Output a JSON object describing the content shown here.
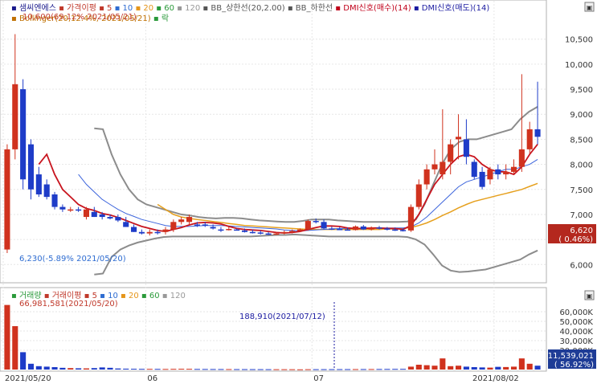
{
  "legend_top": [
    {
      "label": "샘씨엔에스",
      "color": "#1a1a8c",
      "marker": "#d0322a"
    },
    {
      "label": "가격이평",
      "color": "#c0392b"
    },
    {
      "label": "5",
      "color": "#c0392b"
    },
    {
      "label": "10",
      "color": "#2e6cd1"
    },
    {
      "label": "20",
      "color": "#e5951a"
    },
    {
      "label": "60",
      "color": "#2a9a3a"
    },
    {
      "label": "120",
      "color": "#999999"
    },
    {
      "label": "BB_상한선(20,2.00)",
      "color": "#555555"
    },
    {
      "label": "BB_하한선",
      "color": "#555555"
    },
    {
      "label": "DMI신호(매수)(14)",
      "color": "#c0001a"
    },
    {
      "label": "DMI신호(매도)(14)",
      "color": "#1a1aa0"
    }
  ],
  "legend_top2": [
    {
      "label": "Bollinger(20,12.4%, 2021/05/21)",
      "color": "#c07000"
    },
    {
      "label": "락",
      "color": "#2a9a3a"
    }
  ],
  "annotations": {
    "high": "10,600(69.12% 2021/05/21)",
    "low": "6,230(-5.89% 2021/05/20)",
    "volume_max": "66,981,581(2021/05/20)",
    "volume_mark": "188,910(2021/07/12)"
  },
  "current_price": {
    "value": "6,620",
    "change": "(  0.46%)"
  },
  "current_volume": {
    "value": "11,539,021",
    "change": "(  56.92%)"
  },
  "volume_legend": [
    {
      "label": "거래량",
      "color": "#2a9a3a"
    },
    {
      "label": "거래이평",
      "color": "#c0392b"
    },
    {
      "label": "5",
      "color": "#c0392b"
    },
    {
      "label": "10",
      "color": "#2e6cd1"
    },
    {
      "label": "20",
      "color": "#e5951a"
    },
    {
      "label": "60",
      "color": "#2a9a3a"
    },
    {
      "label": "120",
      "color": "#999999"
    }
  ],
  "colors": {
    "up": "#d0321e",
    "down": "#1e3cc8",
    "ma5": "#c8141e",
    "ma10": "#3c64dc",
    "ma20": "#e6a01e",
    "bb": "#8c8c8c",
    "grid": "#e6e6e6",
    "current_bg": "#b4281e",
    "volume_current_bg": "#1e3c96"
  },
  "chart_data": [
    {
      "type": "candlestick",
      "title": "샘씨엔에스",
      "x_ticks": [
        "2021/05/20",
        "06",
        "07",
        "2021/08/02"
      ],
      "y_ticks": [
        "10,500",
        "10,000",
        "9,500",
        "9,000",
        "8,500",
        "8,000",
        "7,500",
        "7,000",
        "6,500",
        "6,000"
      ],
      "ylim": [
        5700,
        10800
      ],
      "candles": [
        {
          "o": 6300,
          "h": 8400,
          "l": 6230,
          "c": 8300
        },
        {
          "o": 8300,
          "h": 10600,
          "l": 8100,
          "c": 9600
        },
        {
          "o": 9500,
          "h": 9700,
          "l": 7500,
          "c": 7700
        },
        {
          "o": 8400,
          "h": 8500,
          "l": 7300,
          "c": 7500
        },
        {
          "o": 7800,
          "h": 7950,
          "l": 7350,
          "c": 7400
        },
        {
          "o": 7600,
          "h": 7700,
          "l": 7300,
          "c": 7350
        },
        {
          "o": 7400,
          "h": 7450,
          "l": 7100,
          "c": 7150
        },
        {
          "o": 7150,
          "h": 7200,
          "l": 7050,
          "c": 7100
        },
        {
          "o": 7100,
          "h": 7150,
          "l": 7050,
          "c": 7100
        },
        {
          "o": 7100,
          "h": 7150,
          "l": 7050,
          "c": 7080
        },
        {
          "o": 6950,
          "h": 7150,
          "l": 6900,
          "c": 7100
        },
        {
          "o": 7050,
          "h": 7150,
          "l": 6950,
          "c": 6950
        },
        {
          "o": 7000,
          "h": 7050,
          "l": 6900,
          "c": 6950
        },
        {
          "o": 6950,
          "h": 7000,
          "l": 6900,
          "c": 6920
        },
        {
          "o": 6950,
          "h": 7000,
          "l": 6850,
          "c": 6880
        },
        {
          "o": 6850,
          "h": 6950,
          "l": 6750,
          "c": 6750
        },
        {
          "o": 6750,
          "h": 6800,
          "l": 6650,
          "c": 6650
        },
        {
          "o": 6650,
          "h": 6700,
          "l": 6600,
          "c": 6620
        },
        {
          "o": 6620,
          "h": 6700,
          "l": 6580,
          "c": 6650
        },
        {
          "o": 6650,
          "h": 6700,
          "l": 6600,
          "c": 6630
        },
        {
          "o": 6650,
          "h": 6750,
          "l": 6600,
          "c": 6700
        },
        {
          "o": 6700,
          "h": 6900,
          "l": 6650,
          "c": 6850
        },
        {
          "o": 6850,
          "h": 6950,
          "l": 6800,
          "c": 6900
        },
        {
          "o": 6850,
          "h": 7000,
          "l": 6800,
          "c": 6950
        },
        {
          "o": 6800,
          "h": 6850,
          "l": 6750,
          "c": 6780
        },
        {
          "o": 6800,
          "h": 6850,
          "l": 6750,
          "c": 6780
        },
        {
          "o": 6750,
          "h": 6800,
          "l": 6700,
          "c": 6720
        },
        {
          "o": 6700,
          "h": 6750,
          "l": 6650,
          "c": 6680
        },
        {
          "o": 6700,
          "h": 6750,
          "l": 6680,
          "c": 6710
        },
        {
          "o": 6700,
          "h": 6720,
          "l": 6680,
          "c": 6690
        },
        {
          "o": 6680,
          "h": 6720,
          "l": 6640,
          "c": 6650
        },
        {
          "o": 6650,
          "h": 6700,
          "l": 6620,
          "c": 6640
        },
        {
          "o": 6640,
          "h": 6680,
          "l": 6600,
          "c": 6620
        },
        {
          "o": 6620,
          "h": 6650,
          "l": 6590,
          "c": 6600
        },
        {
          "o": 6600,
          "h": 6650,
          "l": 6590,
          "c": 6620
        },
        {
          "o": 6620,
          "h": 6680,
          "l": 6600,
          "c": 6650
        },
        {
          "o": 6650,
          "h": 6700,
          "l": 6620,
          "c": 6670
        },
        {
          "o": 6670,
          "h": 6720,
          "l": 6650,
          "c": 6700
        },
        {
          "o": 6700,
          "h": 6900,
          "l": 6680,
          "c": 6870
        },
        {
          "o": 6870,
          "h": 6920,
          "l": 6820,
          "c": 6850
        },
        {
          "o": 6850,
          "h": 6900,
          "l": 6700,
          "c": 6720
        },
        {
          "o": 6720,
          "h": 6760,
          "l": 6690,
          "c": 6710
        },
        {
          "o": 6710,
          "h": 6750,
          "l": 6690,
          "c": 6700
        },
        {
          "o": 6700,
          "h": 6740,
          "l": 6680,
          "c": 6690
        },
        {
          "o": 6690,
          "h": 6780,
          "l": 6680,
          "c": 6760
        },
        {
          "o": 6760,
          "h": 6790,
          "l": 6690,
          "c": 6700
        },
        {
          "o": 6700,
          "h": 6760,
          "l": 6680,
          "c": 6740
        },
        {
          "o": 6740,
          "h": 6770,
          "l": 6700,
          "c": 6720
        },
        {
          "o": 6720,
          "h": 6750,
          "l": 6680,
          "c": 6700
        },
        {
          "o": 6700,
          "h": 6740,
          "l": 6670,
          "c": 6690
        },
        {
          "o": 6690,
          "h": 6720,
          "l": 6660,
          "c": 6680
        },
        {
          "o": 6680,
          "h": 7200,
          "l": 6650,
          "c": 7150
        },
        {
          "o": 7150,
          "h": 7700,
          "l": 7100,
          "c": 7600
        },
        {
          "o": 7600,
          "h": 8000,
          "l": 7500,
          "c": 7900
        },
        {
          "o": 7900,
          "h": 8300,
          "l": 7800,
          "c": 8000
        },
        {
          "o": 7800,
          "h": 9100,
          "l": 7700,
          "c": 8050
        },
        {
          "o": 8050,
          "h": 8500,
          "l": 7800,
          "c": 8400
        },
        {
          "o": 8500,
          "h": 9000,
          "l": 8100,
          "c": 8550
        },
        {
          "o": 8500,
          "h": 8900,
          "l": 8000,
          "c": 8150
        },
        {
          "o": 8050,
          "h": 8100,
          "l": 7700,
          "c": 7750
        },
        {
          "o": 7850,
          "h": 7950,
          "l": 7500,
          "c": 7550
        },
        {
          "o": 7700,
          "h": 7950,
          "l": 7600,
          "c": 7900
        },
        {
          "o": 7900,
          "h": 8000,
          "l": 7700,
          "c": 7800
        },
        {
          "o": 7800,
          "h": 8000,
          "l": 7700,
          "c": 7850
        },
        {
          "o": 7850,
          "h": 8100,
          "l": 7800,
          "c": 7950
        },
        {
          "o": 7950,
          "h": 9800,
          "l": 7850,
          "c": 8300
        },
        {
          "o": 8300,
          "h": 8850,
          "l": 8200,
          "c": 8700
        },
        {
          "o": 8700,
          "h": 9650,
          "l": 8400,
          "c": 8550
        }
      ],
      "ma5": [
        null,
        null,
        null,
        null,
        8000,
        8200,
        7800,
        7500,
        7350,
        7200,
        7120,
        7080,
        7020,
        6990,
        6940,
        6880,
        6820,
        6760,
        6720,
        6680,
        6660,
        6700,
        6740,
        6790,
        6830,
        6840,
        6830,
        6810,
        6760,
        6720,
        6700,
        6690,
        6680,
        6660,
        6640,
        6630,
        6640,
        6660,
        6700,
        6740,
        6770,
        6770,
        6760,
        6730,
        6720,
        6720,
        6730,
        6730,
        6720,
        6720,
        6700,
        6780,
        7000,
        7300,
        7600,
        7800,
        8000,
        8150,
        8200,
        8150,
        8000,
        7900,
        7850,
        7850,
        7800,
        7950,
        8200,
        8400
      ],
      "ma10": [
        null,
        null,
        null,
        null,
        null,
        null,
        null,
        null,
        null,
        7800,
        7600,
        7450,
        7300,
        7200,
        7100,
        7020,
        6960,
        6900,
        6860,
        6820,
        6780,
        6760,
        6760,
        6760,
        6770,
        6780,
        6780,
        6780,
        6770,
        6760,
        6750,
        6740,
        6730,
        6720,
        6710,
        6690,
        6680,
        6670,
        6680,
        6690,
        6700,
        6710,
        6720,
        6720,
        6720,
        6720,
        6720,
        6730,
        6730,
        6730,
        6730,
        6750,
        6830,
        6950,
        7100,
        7250,
        7400,
        7550,
        7650,
        7700,
        7750,
        7800,
        7850,
        7900,
        7900,
        7950,
        8000,
        8100
      ],
      "ma20": [
        null,
        null,
        null,
        null,
        null,
        null,
        null,
        null,
        null,
        null,
        null,
        null,
        null,
        null,
        null,
        null,
        null,
        null,
        null,
        7200,
        7100,
        7000,
        6950,
        6920,
        6900,
        6880,
        6860,
        6840,
        6820,
        6800,
        6780,
        6770,
        6760,
        6750,
        6740,
        6730,
        6720,
        6710,
        6700,
        6700,
        6700,
        6700,
        6700,
        6700,
        6700,
        6700,
        6700,
        6700,
        6710,
        6710,
        6720,
        6740,
        6780,
        6830,
        6900,
        6980,
        7050,
        7130,
        7200,
        7260,
        7300,
        7340,
        7380,
        7420,
        7460,
        7500,
        7560,
        7620
      ],
      "bb_upper": [
        null,
        null,
        null,
        null,
        null,
        null,
        null,
        null,
        null,
        null,
        null,
        null,
        null,
        null,
        null,
        null,
        null,
        null,
        null,
        null,
        null,
        null,
        null,
        null,
        null,
        null,
        null,
        null,
        null,
        null,
        null,
        null,
        null,
        null,
        null,
        null,
        null,
        null,
        null,
        null,
        null,
        null,
        null,
        null,
        null,
        null,
        null,
        null,
        null,
        null,
        null,
        null,
        null,
        null,
        null,
        null,
        null,
        null,
        null,
        null,
        null,
        null,
        null,
        null,
        null,
        null,
        null,
        null
      ],
      "bb_upper_pts": [
        [
          8720,
          0
        ],
        [
          8700,
          1
        ],
        [
          8200,
          2
        ],
        [
          7800,
          3
        ],
        [
          7500,
          4
        ],
        [
          7300,
          5
        ],
        [
          7200,
          6
        ],
        [
          7150,
          7
        ],
        [
          7100,
          8
        ],
        [
          7050,
          9
        ],
        [
          7000,
          10
        ],
        [
          6980,
          11
        ],
        [
          6950,
          12
        ],
        [
          6930,
          13
        ],
        [
          6920,
          14
        ],
        [
          6930,
          15
        ],
        [
          6930,
          16
        ],
        [
          6920,
          17
        ],
        [
          6900,
          18
        ],
        [
          6880,
          19
        ],
        [
          6870,
          20
        ],
        [
          6860,
          21
        ],
        [
          6850,
          22
        ],
        [
          6850,
          23
        ],
        [
          6870,
          24
        ],
        [
          6900,
          25
        ],
        [
          6900,
          26
        ],
        [
          6900,
          27
        ],
        [
          6880,
          28
        ],
        [
          6870,
          29
        ],
        [
          6860,
          30
        ],
        [
          6850,
          31
        ],
        [
          6850,
          32
        ],
        [
          6850,
          33
        ],
        [
          6850,
          34
        ],
        [
          6850,
          35
        ],
        [
          6860,
          36
        ],
        [
          6900,
          37
        ],
        [
          7200,
          38
        ],
        [
          7600,
          39
        ],
        [
          8000,
          40
        ],
        [
          8300,
          41
        ],
        [
          8450,
          42
        ],
        [
          8500,
          43
        ],
        [
          8500,
          44
        ],
        [
          8550,
          45
        ],
        [
          8600,
          46
        ],
        [
          8650,
          47
        ],
        [
          8700,
          48
        ],
        [
          8900,
          49
        ],
        [
          9050,
          50
        ],
        [
          9150,
          51
        ]
      ],
      "bb_lower_pts": [
        [
          5800,
          0
        ],
        [
          5820,
          1
        ],
        [
          6150,
          2
        ],
        [
          6300,
          3
        ],
        [
          6380,
          4
        ],
        [
          6440,
          5
        ],
        [
          6480,
          6
        ],
        [
          6520,
          7
        ],
        [
          6550,
          8
        ],
        [
          6560,
          9
        ],
        [
          6560,
          10
        ],
        [
          6560,
          11
        ],
        [
          6560,
          12
        ],
        [
          6560,
          13
        ],
        [
          6560,
          14
        ],
        [
          6560,
          15
        ],
        [
          6560,
          16
        ],
        [
          6560,
          17
        ],
        [
          6560,
          18
        ],
        [
          6570,
          19
        ],
        [
          6580,
          20
        ],
        [
          6590,
          21
        ],
        [
          6590,
          22
        ],
        [
          6600,
          23
        ],
        [
          6590,
          24
        ],
        [
          6580,
          25
        ],
        [
          6570,
          26
        ],
        [
          6560,
          27
        ],
        [
          6560,
          28
        ],
        [
          6560,
          29
        ],
        [
          6560,
          30
        ],
        [
          6560,
          31
        ],
        [
          6560,
          32
        ],
        [
          6560,
          33
        ],
        [
          6560,
          34
        ],
        [
          6560,
          35
        ],
        [
          6550,
          36
        ],
        [
          6500,
          37
        ],
        [
          6400,
          38
        ],
        [
          6200,
          39
        ],
        [
          5980,
          40
        ],
        [
          5880,
          41
        ],
        [
          5850,
          42
        ],
        [
          5860,
          43
        ],
        [
          5880,
          44
        ],
        [
          5900,
          45
        ],
        [
          5950,
          46
        ],
        [
          6000,
          47
        ],
        [
          6050,
          48
        ],
        [
          6100,
          49
        ],
        [
          6200,
          50
        ],
        [
          6280,
          51
        ]
      ],
      "volume": [
        66981581,
        45000000,
        18000000,
        6000000,
        3500000,
        3000000,
        2500000,
        1800000,
        1500000,
        1300000,
        1200000,
        1500000,
        2200000,
        1800000,
        1100000,
        900000,
        800000,
        700000,
        700000,
        650000,
        600000,
        700000,
        800000,
        750000,
        600000,
        550000,
        500000,
        480000,
        450000,
        420000,
        400000,
        380000,
        360000,
        340000,
        320000,
        310000,
        300000,
        188910,
        320000,
        340000,
        360000,
        380000,
        400000,
        420000,
        440000,
        460000,
        500000,
        550000,
        600000,
        650000,
        700000,
        3000000,
        5000000,
        4500000,
        4000000,
        11539021,
        3500000,
        4000000,
        3000000,
        2500000,
        2200000,
        2000000,
        2800000,
        2600000,
        3000000,
        11539021,
        6000000,
        4000000
      ],
      "volume_ylim": [
        0,
        70000000
      ],
      "volume_ticks": [
        "60,000K",
        "50,000K",
        "40,000K",
        "30,000K",
        "20,000K"
      ]
    }
  ]
}
